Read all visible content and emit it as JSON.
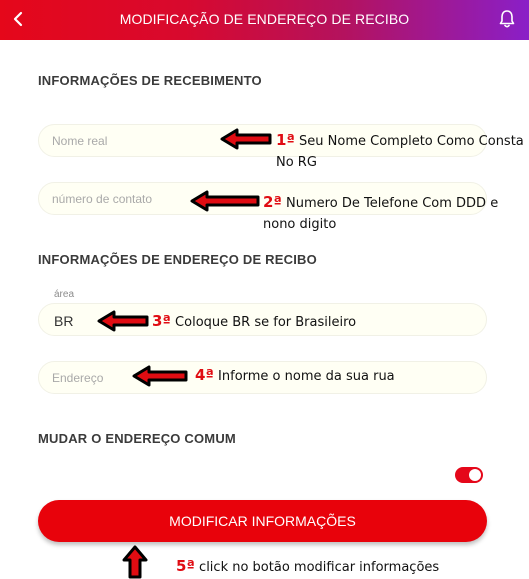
{
  "header": {
    "title": "MODIFICAÇÃO DE ENDEREÇO DE RECIBO",
    "back_icon": "back-arrow-icon",
    "notification_icon": "bell-icon"
  },
  "sections": {
    "receiving_info": "INFORMAÇÕES DE RECEBIMENTO",
    "address_info": "INFORMAÇÕES DE ENDEREÇO DE RECIBO",
    "change_common": "MUDAR O ENDEREÇO COMUM"
  },
  "form": {
    "real_name_placeholder": "Nome real",
    "contact_number_placeholder": "número de contato",
    "area_label": "área",
    "area_value": "BR",
    "address_placeholder": "Endereço",
    "common_address_toggle": "on"
  },
  "submit_label": "MODIFICAR INFORMAÇÕES",
  "annotations": {
    "a1_num": "1ª",
    "a1_line1": "Seu Nome Completo Como Consta",
    "a1_line2": "No RG",
    "a2_num": "2ª",
    "a2_line1": "Numero De Telefone Com DDD e",
    "a2_line2": "nono digito",
    "a3_num": "3ª",
    "a3_text": "Coloque BR se for Brasileiro",
    "a4_num": "4ª",
    "a4_text": "Informe o nome da sua rua",
    "a5_num": "5ª",
    "a5_text": "click no botão modificar informações"
  },
  "colors": {
    "header_start": "#e5071a",
    "header_end": "#8a1fc8",
    "accent_red": "#e8020b",
    "annotation_number": "#e00c12",
    "field_bg": "#fffff4"
  }
}
